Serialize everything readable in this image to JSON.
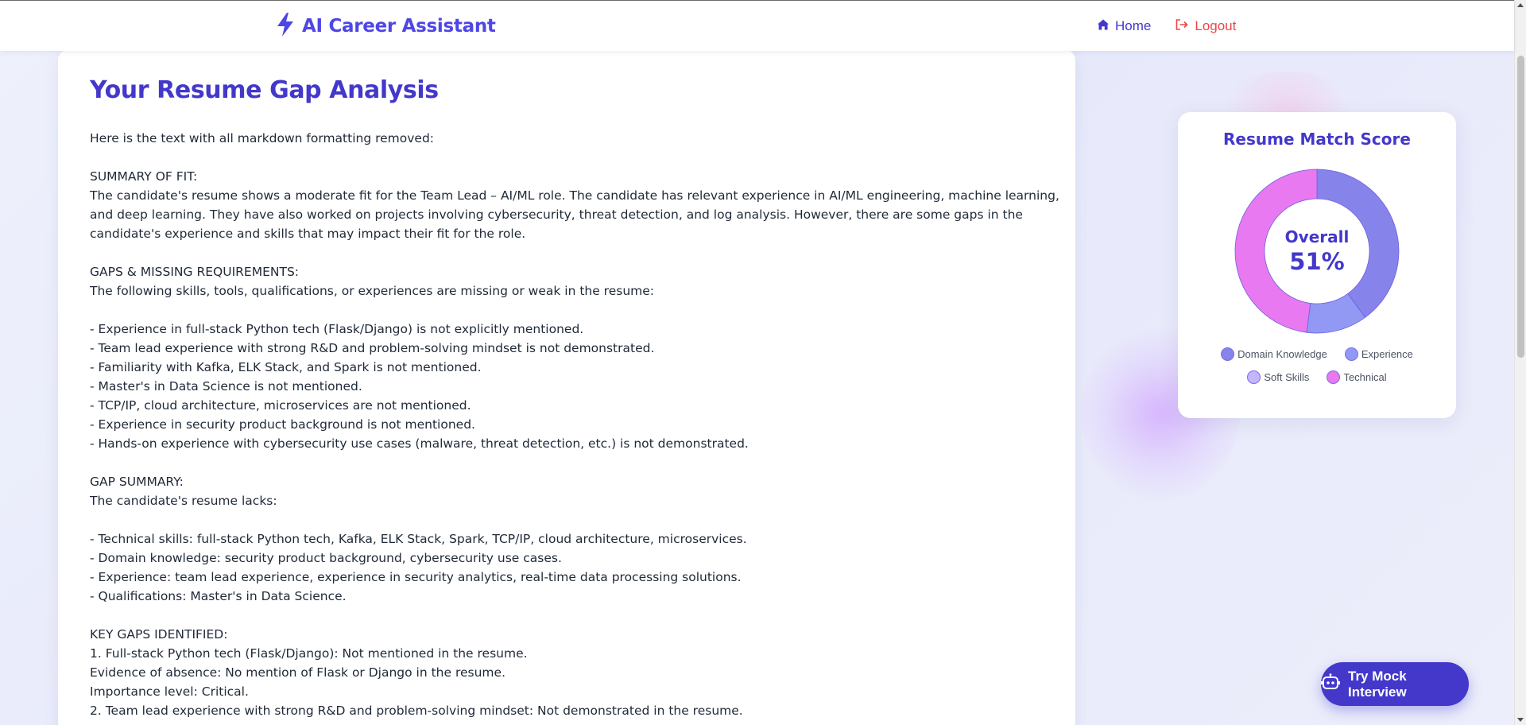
{
  "header": {
    "brand": "AI Career Assistant",
    "nav": [
      {
        "label": "Home",
        "icon": "home-icon"
      },
      {
        "label": "Logout",
        "icon": "logout-icon"
      }
    ]
  },
  "main": {
    "title": "Your Resume Gap Analysis",
    "lines": [
      "Here is the text with all markdown formatting removed:",
      "",
      "SUMMARY OF FIT:",
      "The candidate's resume shows a moderate fit for the Team Lead – AI/ML role. The candidate has relevant experience in AI/ML engineering, machine learning,",
      "and deep learning. They have also worked on projects involving cybersecurity, threat detection, and log analysis. However, there are some gaps in the",
      "candidate's experience and skills that may impact their fit for the role.",
      "",
      "GAPS & MISSING REQUIREMENTS:",
      "The following skills, tools, qualifications, or experiences are missing or weak in the resume:",
      "",
      "- Experience in full-stack Python tech (Flask/Django) is not explicitly mentioned.",
      "- Team lead experience with strong R&D and problem-solving mindset is not demonstrated.",
      "- Familiarity with Kafka, ELK Stack, and Spark is not mentioned.",
      "- Master's in Data Science is not mentioned.",
      "- TCP/IP, cloud architecture, microservices are not mentioned.",
      "- Experience in security product background is not mentioned.",
      "- Hands-on experience with cybersecurity use cases (malware, threat detection, etc.) is not demonstrated.",
      "",
      "GAP SUMMARY:",
      "The candidate's resume lacks:",
      "",
      "- Technical skills: full-stack Python tech, Kafka, ELK Stack, Spark, TCP/IP, cloud architecture, microservices.",
      "- Domain knowledge: security product background, cybersecurity use cases.",
      "- Experience: team lead experience, experience in security analytics, real-time data processing solutions.",
      "- Qualifications: Master's in Data Science.",
      "",
      "KEY GAPS IDENTIFIED:",
      "1. Full-stack Python tech (Flask/Django): Not mentioned in the resume.",
      "Evidence of absence: No mention of Flask or Django in the resume.",
      "Importance level: Critical.",
      "2. Team lead experience with strong R&D and problem-solving mindset: Not demonstrated in the resume."
    ]
  },
  "score_card": {
    "title": "Resume Match Score",
    "center_label": "Overall",
    "center_value": "51%",
    "segments": [
      {
        "label": "Domain Knowledge",
        "fraction": 0.4,
        "color": "#8684ea"
      },
      {
        "label": "Experience",
        "fraction": 0.12,
        "color": "#9199f5"
      },
      {
        "label": "Soft Skills",
        "fraction": 0.0,
        "color": "#c4b5fd"
      },
      {
        "label": "Technical",
        "fraction": 0.48,
        "color": "#e879f0"
      }
    ]
  },
  "floating": {
    "mock_interview_label": "Try Mock Interview",
    "icon": "robot-icon"
  }
}
